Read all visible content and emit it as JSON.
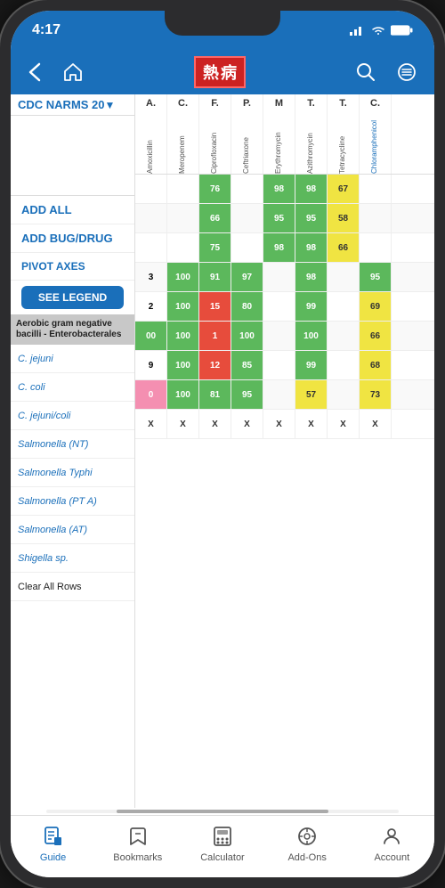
{
  "status": {
    "time": "4:17",
    "location_icon": "▶",
    "signal": "▂▄▆",
    "wifi": "wifi",
    "battery": "🔋"
  },
  "nav": {
    "back_label": "‹",
    "home_label": "⌂",
    "logo_chars": [
      "熱",
      "病"
    ],
    "search_label": "search",
    "menu_label": "menu"
  },
  "dropdown": {
    "label": "CDC NARMS 20",
    "arrow": "▼"
  },
  "col_headers": [
    {
      "abbr": "A.",
      "full": "Amoxicillin",
      "blue": false
    },
    {
      "abbr": "C.",
      "full": "Meropenem",
      "blue": false
    },
    {
      "abbr": "F.",
      "full": "Ciprofloxacin",
      "blue": false
    },
    {
      "abbr": "P.",
      "full": "Ceftriaxone",
      "blue": false
    },
    {
      "abbr": "M",
      "full": "Erythromycin",
      "blue": false
    },
    {
      "abbr": "T.",
      "full": "Azithromycin",
      "blue": false
    },
    {
      "abbr": "T.",
      "full": "Tetracycline",
      "blue": false
    },
    {
      "abbr": "C.",
      "full": "Chloramphenicol",
      "blue": true
    }
  ],
  "sidebar": {
    "add_all": "ADD ALL",
    "add_bug_drug": "ADD BUG/DRUG",
    "pivot_axes": "PIVOT AXES",
    "see_legend": "SEE LEGEND"
  },
  "section_header": "Aerobic gram negative bacilli - Enterobacterales",
  "rows": [
    {
      "name": "C. jejuni",
      "italic": true,
      "cells": [
        {
          "val": "",
          "cls": ""
        },
        {
          "val": "",
          "cls": ""
        },
        {
          "val": "76",
          "cls": "green"
        },
        {
          "val": "",
          "cls": ""
        },
        {
          "val": "98",
          "cls": "green"
        },
        {
          "val": "98",
          "cls": "green"
        },
        {
          "val": "67",
          "cls": "yellow"
        },
        {
          "val": "",
          "cls": ""
        }
      ]
    },
    {
      "name": "C. coli",
      "italic": true,
      "cells": [
        {
          "val": "",
          "cls": ""
        },
        {
          "val": "",
          "cls": ""
        },
        {
          "val": "66",
          "cls": "green"
        },
        {
          "val": "",
          "cls": ""
        },
        {
          "val": "95",
          "cls": "green"
        },
        {
          "val": "95",
          "cls": "green"
        },
        {
          "val": "58",
          "cls": "yellow"
        },
        {
          "val": "",
          "cls": ""
        }
      ]
    },
    {
      "name": "C. jejuni/coli",
      "italic": true,
      "cells": [
        {
          "val": "",
          "cls": ""
        },
        {
          "val": "",
          "cls": ""
        },
        {
          "val": "75",
          "cls": "green"
        },
        {
          "val": "",
          "cls": ""
        },
        {
          "val": "98",
          "cls": "green"
        },
        {
          "val": "98",
          "cls": "green"
        },
        {
          "val": "66",
          "cls": "yellow"
        },
        {
          "val": "",
          "cls": ""
        }
      ]
    },
    {
      "name": "Salmonella (NT)",
      "italic": true,
      "cells": [
        {
          "val": "3",
          "cls": ""
        },
        {
          "val": "100",
          "cls": "green"
        },
        {
          "val": "91",
          "cls": "green"
        },
        {
          "val": "97",
          "cls": "green"
        },
        {
          "val": "",
          "cls": ""
        },
        {
          "val": "98",
          "cls": "green"
        },
        {
          "val": "",
          "cls": ""
        },
        {
          "val": "95",
          "cls": "green"
        }
      ]
    },
    {
      "name": "Salmonella Typhi",
      "italic": true,
      "cells": [
        {
          "val": "2",
          "cls": ""
        },
        {
          "val": "100",
          "cls": "green"
        },
        {
          "val": "15",
          "cls": "red"
        },
        {
          "val": "80",
          "cls": "green"
        },
        {
          "val": "",
          "cls": ""
        },
        {
          "val": "99",
          "cls": "green"
        },
        {
          "val": "",
          "cls": ""
        },
        {
          "val": "69",
          "cls": "yellow"
        }
      ]
    },
    {
      "name": "Salmonella (PT A)",
      "italic": true,
      "cells": [
        {
          "val": "00",
          "cls": "green"
        },
        {
          "val": "100",
          "cls": "green"
        },
        {
          "val": "1",
          "cls": "red"
        },
        {
          "val": "100",
          "cls": "green"
        },
        {
          "val": "",
          "cls": ""
        },
        {
          "val": "100",
          "cls": "green"
        },
        {
          "val": "",
          "cls": ""
        },
        {
          "val": "66",
          "cls": "yellow"
        }
      ]
    },
    {
      "name": "Salmonella (AT)",
      "italic": true,
      "cells": [
        {
          "val": "9",
          "cls": ""
        },
        {
          "val": "100",
          "cls": "green"
        },
        {
          "val": "12",
          "cls": "red"
        },
        {
          "val": "85",
          "cls": "green"
        },
        {
          "val": "",
          "cls": ""
        },
        {
          "val": "99",
          "cls": "green"
        },
        {
          "val": "",
          "cls": ""
        },
        {
          "val": "68",
          "cls": "yellow"
        }
      ]
    },
    {
      "name": "Shigella sp.",
      "italic": true,
      "cells": [
        {
          "val": "0",
          "cls": "pink"
        },
        {
          "val": "100",
          "cls": "green"
        },
        {
          "val": "81",
          "cls": "green"
        },
        {
          "val": "95",
          "cls": "green"
        },
        {
          "val": "",
          "cls": ""
        },
        {
          "val": "57",
          "cls": "yellow"
        },
        {
          "val": "",
          "cls": ""
        },
        {
          "val": "73",
          "cls": "yellow"
        }
      ]
    },
    {
      "name": "Clear All Rows",
      "italic": false,
      "cells": [
        {
          "val": "X",
          "cls": "x"
        },
        {
          "val": "X",
          "cls": "x"
        },
        {
          "val": "X",
          "cls": "x"
        },
        {
          "val": "X",
          "cls": "x"
        },
        {
          "val": "X",
          "cls": "x"
        },
        {
          "val": "X",
          "cls": "x"
        },
        {
          "val": "X",
          "cls": "x"
        },
        {
          "val": "X",
          "cls": "x"
        }
      ]
    }
  ],
  "tabs": [
    {
      "icon": "guide",
      "label": "Guide",
      "active": true
    },
    {
      "icon": "bookmarks",
      "label": "Bookmarks",
      "active": false
    },
    {
      "icon": "calculator",
      "label": "Calculator",
      "active": false
    },
    {
      "icon": "addons",
      "label": "Add-Ons",
      "active": false
    },
    {
      "icon": "account",
      "label": "Account",
      "active": false
    }
  ]
}
